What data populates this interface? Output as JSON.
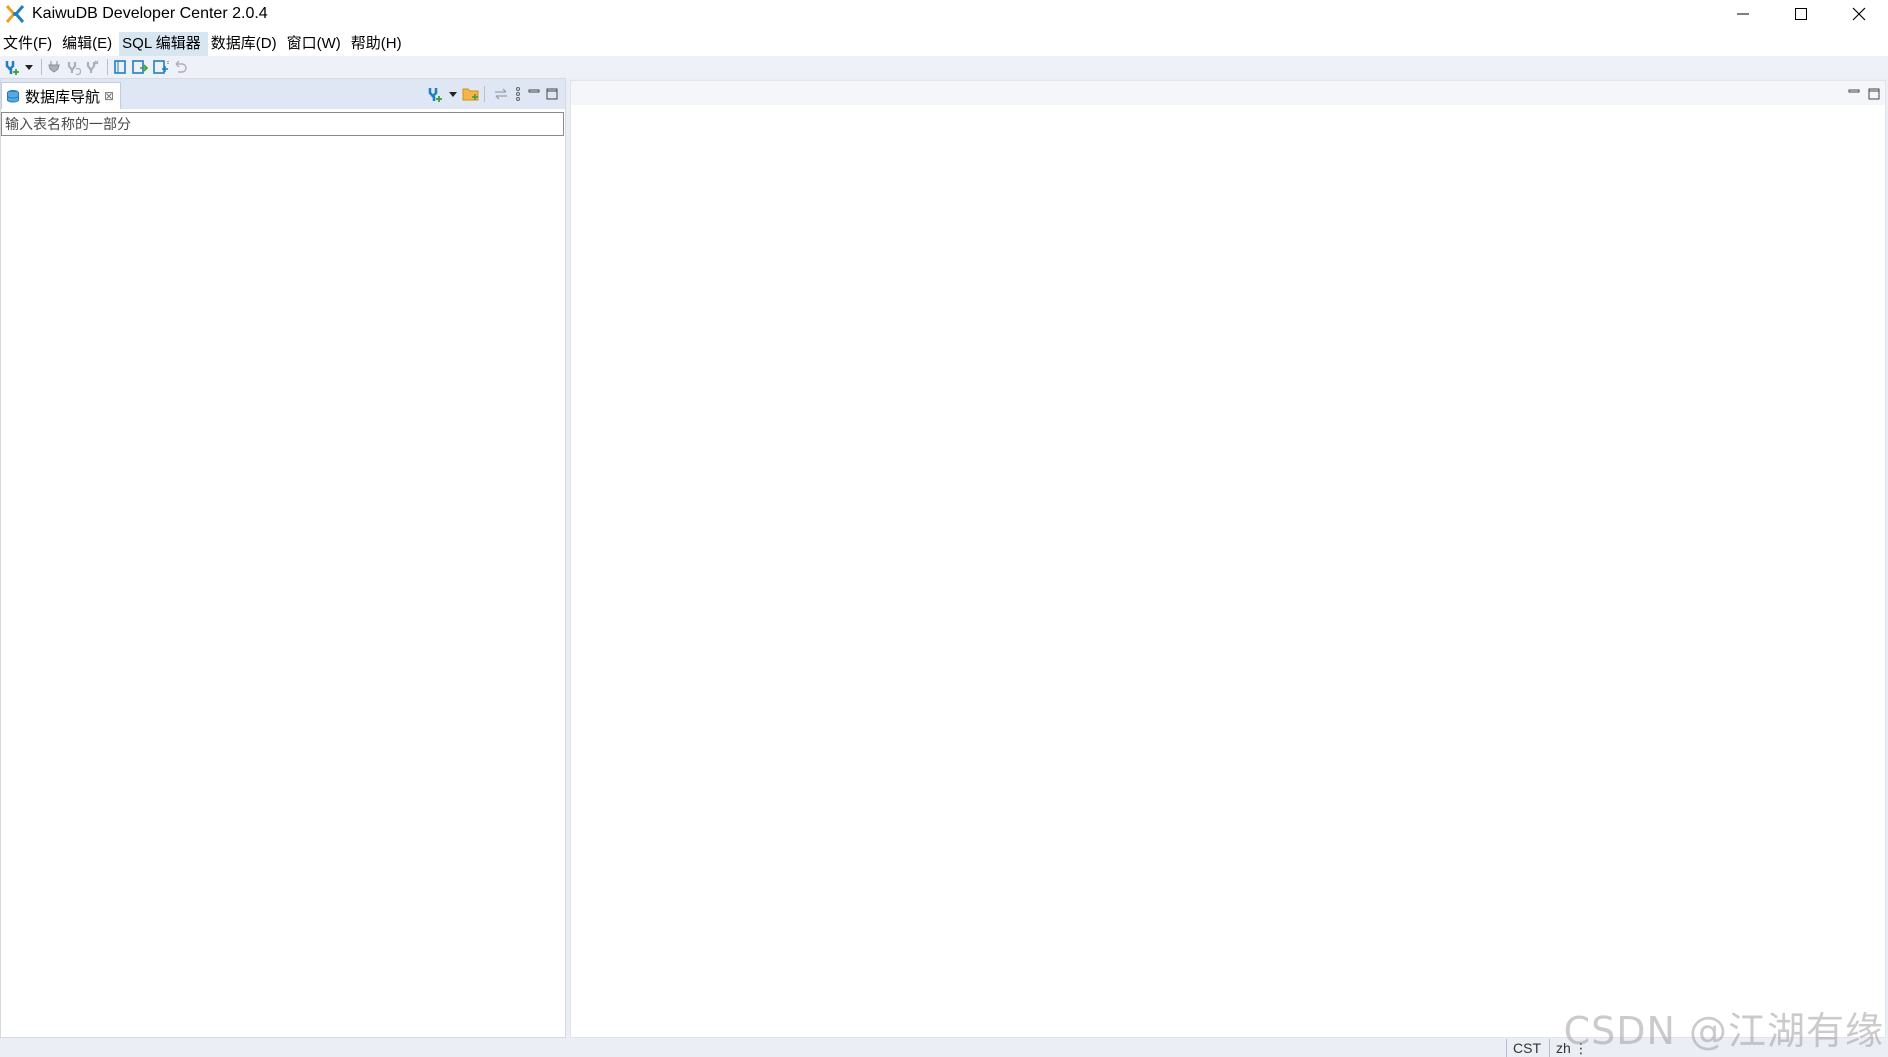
{
  "window": {
    "title": "KaiwuDB Developer Center 2.0.4",
    "controls": {
      "minimize": "—",
      "maximize": "☐",
      "close": "✕"
    }
  },
  "menu": {
    "items": [
      {
        "label": "文件(F)"
      },
      {
        "label": "编辑(E)"
      },
      {
        "label": "SQL 编辑器",
        "active": true
      },
      {
        "label": "数据库(D)"
      },
      {
        "label": "窗口(W)"
      },
      {
        "label": "帮助(H)"
      }
    ]
  },
  "toolbar": {
    "icons": [
      "new-connection-icon",
      "dropdown-arrow-icon",
      "connect-icon",
      "reconnect-icon",
      "disconnect-icon",
      "commit-icon",
      "rollback-icon",
      "transaction-mode-icon",
      "auto-commit-icon"
    ]
  },
  "navigator": {
    "tab_label": "数据库导航",
    "tab_close": "⊠",
    "filter_placeholder": "输入表名称的一部分",
    "tool_icons": [
      "new-connection-icon",
      "dropdown-arrow-icon",
      "new-folder-icon",
      "link-editor-icon",
      "view-menu-icon",
      "minimize-icon",
      "maximize-icon"
    ]
  },
  "editor_area": {
    "tool_icons": [
      "minimize-icon",
      "maximize-icon"
    ]
  },
  "status": {
    "timezone": "CST",
    "locale": "zh",
    "menu": "⋮"
  },
  "watermark": "CSDN @江湖有缘",
  "colors": {
    "accent": "#1f7fc4",
    "toolbar_bg": "#eef1f8",
    "tab_bar_bg": "#dfe7f4",
    "menu_active": "#d8e6f2"
  }
}
